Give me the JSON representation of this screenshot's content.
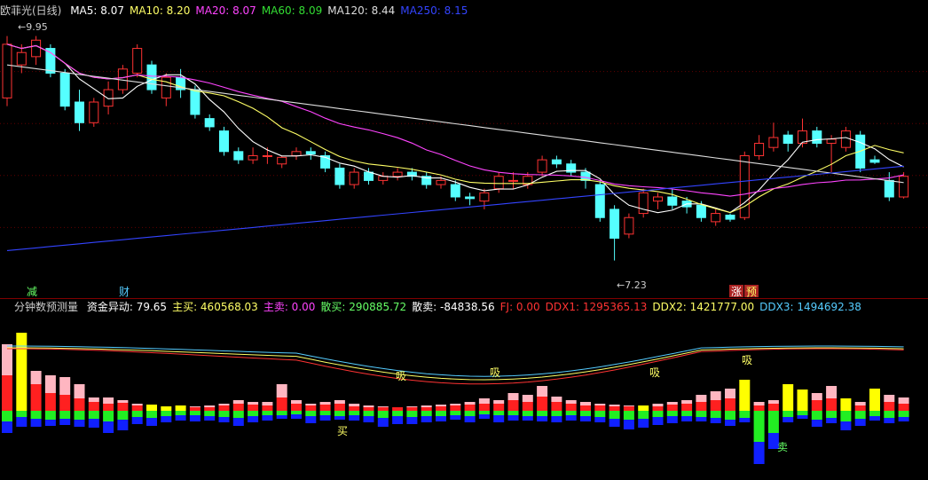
{
  "main_header": {
    "stock": "欧菲光(日线)",
    "ma": [
      {
        "label": "MA5: 8.07",
        "color": "#ffffff"
      },
      {
        "label": "MA10: 8.20",
        "color": "#ffff66"
      },
      {
        "label": "MA20: 8.07",
        "color": "#ff44ff"
      },
      {
        "label": "MA60: 8.09",
        "color": "#33dd33"
      },
      {
        "label": "MA120: 8.44",
        "color": "#dddddd"
      },
      {
        "label": "MA250: 8.15",
        "color": "#3344ff"
      }
    ]
  },
  "main_annotations": {
    "high": "9.95",
    "low": "7.23",
    "tag1": "减",
    "tag2": "财",
    "tag3": "涨",
    "tag4": "预"
  },
  "ind_header": {
    "name": "分钟数预测量",
    "items": [
      {
        "label": "资金异动: 79.65",
        "color": "#ffffff"
      },
      {
        "label": "主买: 460568.03",
        "color": "#ffff66"
      },
      {
        "label": "主卖: 0.00",
        "color": "#ff44ff"
      },
      {
        "label": "散买: 290885.72",
        "color": "#66ff66"
      },
      {
        "label": "散卖: -84838.56",
        "color": "#ffffff"
      },
      {
        "label": "FJ: 0.00",
        "color": "#ff3333"
      },
      {
        "label": "DDX1: 1295365.13",
        "color": "#ff3333"
      },
      {
        "label": "DDX2: 1421777.00",
        "color": "#ffff66"
      },
      {
        "label": "DDX3: 1494692.38",
        "color": "#55ccff"
      }
    ]
  },
  "ind_annotations": {
    "xi": "吸",
    "buy": "买",
    "sell": "卖"
  },
  "colors": {
    "up": "#ff3333",
    "down": "#55ffff",
    "ma5": "#ffffff",
    "ma10": "#ffff66",
    "ma20": "#ff44ff",
    "ma60": "#33dd33",
    "ma120": "#dddddd",
    "ma250": "#3344ff",
    "pink": "#ffb6c1",
    "red": "#ff2020",
    "green": "#22ee22",
    "blue": "#1020ff",
    "yellow": "#ffff00"
  },
  "chart_data": {
    "type": "candlestick",
    "ylim": [
      7.0,
      10.15
    ],
    "candles": [
      [
        9.2,
        9.85,
        9.1,
        9.95
      ],
      [
        9.6,
        9.75,
        9.5,
        9.85
      ],
      [
        9.7,
        9.9,
        9.6,
        9.95
      ],
      [
        9.8,
        9.5,
        9.45,
        9.85
      ],
      [
        9.5,
        9.1,
        9.05,
        9.55
      ],
      [
        9.15,
        8.9,
        8.8,
        9.3
      ],
      [
        8.9,
        9.15,
        8.85,
        9.2
      ],
      [
        9.1,
        9.3,
        9.0,
        9.4
      ],
      [
        9.3,
        9.55,
        9.25,
        9.6
      ],
      [
        9.5,
        9.8,
        9.45,
        9.85
      ],
      [
        9.6,
        9.3,
        9.25,
        9.65
      ],
      [
        9.2,
        9.45,
        9.1,
        9.5
      ],
      [
        9.45,
        9.3,
        9.2,
        9.55
      ],
      [
        9.3,
        9.0,
        8.95,
        9.35
      ],
      [
        8.95,
        8.85,
        8.8,
        9.0
      ],
      [
        8.8,
        8.55,
        8.5,
        8.85
      ],
      [
        8.55,
        8.45,
        8.4,
        8.6
      ],
      [
        8.45,
        8.5,
        8.4,
        8.6
      ],
      [
        8.5,
        8.5,
        8.4,
        8.6
      ],
      [
        8.4,
        8.48,
        8.35,
        8.5
      ],
      [
        8.5,
        8.55,
        8.45,
        8.6
      ],
      [
        8.55,
        8.52,
        8.45,
        8.6
      ],
      [
        8.5,
        8.35,
        8.3,
        8.55
      ],
      [
        8.35,
        8.15,
        8.1,
        8.4
      ],
      [
        8.15,
        8.3,
        8.1,
        8.35
      ],
      [
        8.3,
        8.2,
        8.15,
        8.35
      ],
      [
        8.2,
        8.25,
        8.15,
        8.3
      ],
      [
        8.25,
        8.3,
        8.2,
        8.35
      ],
      [
        8.3,
        8.25,
        8.2,
        8.35
      ],
      [
        8.25,
        8.15,
        8.1,
        8.3
      ],
      [
        8.15,
        8.2,
        8.1,
        8.25
      ],
      [
        8.15,
        8.0,
        7.95,
        8.2
      ],
      [
        8.0,
        7.98,
        7.9,
        8.05
      ],
      [
        7.95,
        8.05,
        7.85,
        8.1
      ],
      [
        8.1,
        8.25,
        8.05,
        8.3
      ],
      [
        8.2,
        8.2,
        8.1,
        8.3
      ],
      [
        8.15,
        8.25,
        8.1,
        8.3
      ],
      [
        8.3,
        8.45,
        8.25,
        8.5
      ],
      [
        8.45,
        8.4,
        8.35,
        8.5
      ],
      [
        8.4,
        8.3,
        8.25,
        8.45
      ],
      [
        8.3,
        8.2,
        8.1,
        8.35
      ],
      [
        8.15,
        7.75,
        7.7,
        8.2
      ],
      [
        7.85,
        7.5,
        7.23,
        7.9
      ],
      [
        7.55,
        7.75,
        7.5,
        7.8
      ],
      [
        7.8,
        8.05,
        7.75,
        8.1
      ],
      [
        7.95,
        8.0,
        7.85,
        8.05
      ],
      [
        8.0,
        7.9,
        7.85,
        8.1
      ],
      [
        7.95,
        7.88,
        7.8,
        8.0
      ],
      [
        7.9,
        7.75,
        7.7,
        7.95
      ],
      [
        7.7,
        7.8,
        7.65,
        7.85
      ],
      [
        7.78,
        7.73,
        7.7,
        7.8
      ],
      [
        7.75,
        8.5,
        7.72,
        8.55
      ],
      [
        8.5,
        8.65,
        8.45,
        8.75
      ],
      [
        8.6,
        8.72,
        8.55,
        8.9
      ],
      [
        8.75,
        8.65,
        8.55,
        8.8
      ],
      [
        8.65,
        8.8,
        8.6,
        8.95
      ],
      [
        8.8,
        8.65,
        8.6,
        8.85
      ],
      [
        8.65,
        8.7,
        8.3,
        8.75
      ],
      [
        8.6,
        8.8,
        8.55,
        8.85
      ],
      [
        8.75,
        8.35,
        8.3,
        8.8
      ],
      [
        8.45,
        8.42,
        8.4,
        8.5
      ],
      [
        8.2,
        8.0,
        7.95,
        8.3
      ],
      [
        8.0,
        8.25,
        7.98,
        8.3
      ]
    ],
    "ind_bars": [
      [
        75,
        40,
        12,
        13
      ],
      [
        88,
        50,
        7,
        11
      ],
      [
        45,
        30,
        9,
        9
      ],
      [
        40,
        20,
        10,
        7
      ],
      [
        38,
        18,
        9,
        7
      ],
      [
        30,
        14,
        10,
        8
      ],
      [
        15,
        10,
        9,
        10
      ],
      [
        15,
        8,
        12,
        13
      ],
      [
        12,
        9,
        10,
        12
      ],
      [
        8,
        6,
        7,
        8
      ],
      [
        7,
        5,
        8,
        9
      ],
      [
        5,
        4,
        6,
        7
      ],
      [
        6,
        5,
        5,
        6
      ],
      [
        5,
        4,
        5,
        7
      ],
      [
        6,
        4,
        6,
        5
      ],
      [
        8,
        6,
        7,
        6
      ],
      [
        12,
        8,
        8,
        9
      ],
      [
        10,
        7,
        6,
        7
      ],
      [
        10,
        6,
        5,
        6
      ],
      [
        30,
        15,
        5,
        4
      ],
      [
        12,
        8,
        4,
        5
      ],
      [
        8,
        6,
        6,
        8
      ],
      [
        10,
        7,
        5,
        6
      ],
      [
        12,
        8,
        6,
        4
      ],
      [
        8,
        5,
        5,
        6
      ],
      [
        6,
        4,
        6,
        7
      ],
      [
        5,
        4,
        8,
        10
      ],
      [
        4,
        4,
        6,
        9
      ],
      [
        5,
        4,
        7,
        8
      ],
      [
        6,
        4,
        6,
        7
      ],
      [
        7,
        5,
        6,
        6
      ],
      [
        8,
        6,
        5,
        5
      ],
      [
        10,
        7,
        6,
        7
      ],
      [
        14,
        8,
        4,
        5
      ],
      [
        12,
        8,
        5,
        8
      ],
      [
        20,
        12,
        5,
        6
      ],
      [
        18,
        10,
        6,
        5
      ],
      [
        28,
        16,
        6,
        6
      ],
      [
        16,
        10,
        6,
        7
      ],
      [
        12,
        8,
        5,
        6
      ],
      [
        10,
        6,
        6,
        6
      ],
      [
        8,
        6,
        7,
        6
      ],
      [
        7,
        5,
        9,
        9
      ],
      [
        6,
        5,
        10,
        11
      ],
      [
        6,
        5,
        9,
        10
      ],
      [
        8,
        5,
        7,
        9
      ],
      [
        10,
        7,
        6,
        8
      ],
      [
        12,
        8,
        6,
        6
      ],
      [
        18,
        10,
        7,
        5
      ],
      [
        22,
        12,
        8,
        6
      ],
      [
        25,
        14,
        10,
        7
      ],
      [
        35,
        20,
        8,
        5
      ],
      [
        10,
        6,
        35,
        25
      ],
      [
        12,
        8,
        25,
        18
      ],
      [
        30,
        16,
        7,
        6
      ],
      [
        24,
        14,
        5,
        4
      ],
      [
        20,
        12,
        10,
        8
      ],
      [
        28,
        14,
        8,
        6
      ],
      [
        14,
        8,
        12,
        10
      ],
      [
        10,
        6,
        9,
        8
      ],
      [
        25,
        14,
        6,
        5
      ],
      [
        18,
        10,
        8,
        6
      ],
      [
        15,
        8,
        7,
        5
      ]
    ]
  }
}
